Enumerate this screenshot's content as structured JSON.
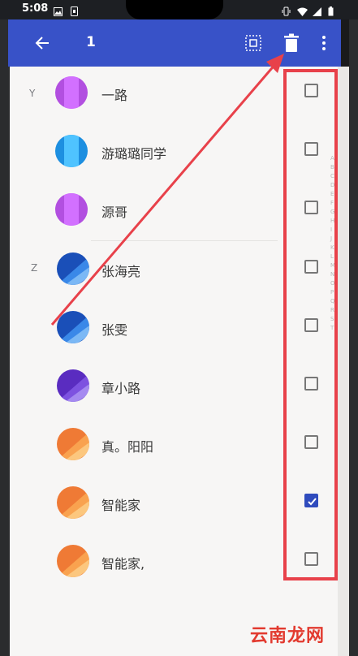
{
  "status_bar": {
    "time": "5:08"
  },
  "toolbar": {
    "selected_count": "1",
    "back_icon": "arrow-left-icon",
    "select_all_icon": "select-all-icon",
    "delete_icon": "trash-icon",
    "more_icon": "more-vertical-icon"
  },
  "sections": [
    {
      "letter": "Y"
    },
    {
      "letter": "Z"
    }
  ],
  "contacts": [
    {
      "name": "一路",
      "checked": false,
      "avatar_color": "#b24fe0"
    },
    {
      "name": "游璐璐同学",
      "checked": false,
      "avatar_color": "#2aa9ee"
    },
    {
      "name": "源哥",
      "checked": false,
      "avatar_color": "#b24fe0"
    },
    {
      "name": "张海亮",
      "checked": false,
      "avatar_color": "#1e5bc8"
    },
    {
      "name": "张雯",
      "checked": false,
      "avatar_color": "#1e5bc8"
    },
    {
      "name": "章小路",
      "checked": false,
      "avatar_color": "#6a38d0"
    },
    {
      "name": "真。阳阳",
      "checked": false,
      "avatar_color": "#f2803a"
    },
    {
      "name": "智能家",
      "checked": true,
      "avatar_color": "#f2803a"
    },
    {
      "name": "智能家,",
      "checked": false,
      "avatar_color": "#f2803a"
    }
  ],
  "watermark": "云南龙网",
  "colors": {
    "toolbar": "#3852c8",
    "checkbox_checked": "#2f4bbd",
    "annotation": "#e8414a"
  }
}
